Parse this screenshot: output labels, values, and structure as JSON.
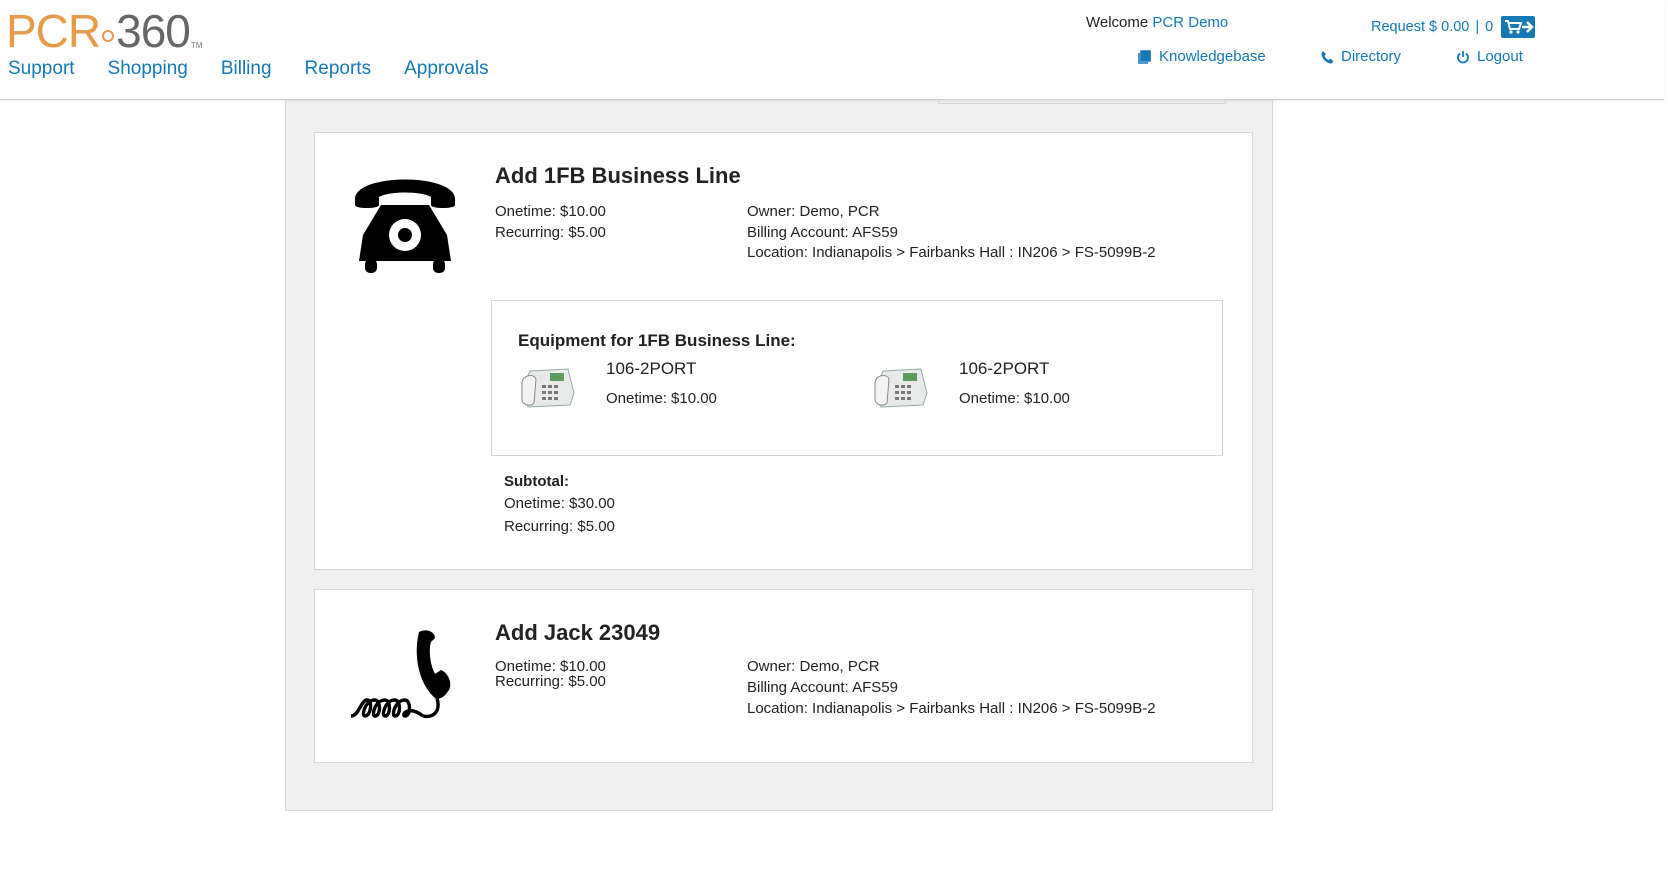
{
  "brand": {
    "pcr": "PCR",
    "num": "360",
    "tm": "TM"
  },
  "nav": [
    "Support",
    "Shopping",
    "Billing",
    "Reports",
    "Approvals"
  ],
  "user": {
    "welcome": "Welcome",
    "name": "PCR Demo"
  },
  "cart": {
    "request_label": "Request $ 0.00",
    "separator": "|",
    "count": "0"
  },
  "links": {
    "knowledgebase": "Knowledgebase",
    "directory": "Directory",
    "logout": "Logout"
  },
  "items": [
    {
      "title": "Add 1FB Business Line",
      "onetime": "Onetime: $10.00",
      "recurring": "Recurring: $5.00",
      "owner": "Owner: Demo, PCR",
      "billing": "Billing Account: AFS59",
      "location": "Location: Indianapolis > Fairbanks Hall : IN206 > FS-5099B-2",
      "equipment_heading": "Equipment for 1FB Business Line:",
      "equipment": [
        {
          "name": "106-2PORT",
          "price": "Onetime: $10.00"
        },
        {
          "name": "106-2PORT",
          "price": "Onetime: $10.00"
        }
      ],
      "subtotal_label": "Subtotal:",
      "subtotal_onetime": "Onetime: $30.00",
      "subtotal_recurring": "Recurring: $5.00"
    },
    {
      "title": "Add Jack 23049",
      "onetime": "Onetime: $10.00",
      "recurring": "Recurring: $5.00",
      "owner": "Owner: Demo, PCR",
      "billing": "Billing Account: AFS59",
      "location": "Location: Indianapolis > Fairbanks Hall : IN206 > FS-5099B-2"
    }
  ],
  "colors": {
    "accent": "#1479b5",
    "logo_orange": "#e69a4a",
    "panel_bg": "#f0f0f0"
  }
}
